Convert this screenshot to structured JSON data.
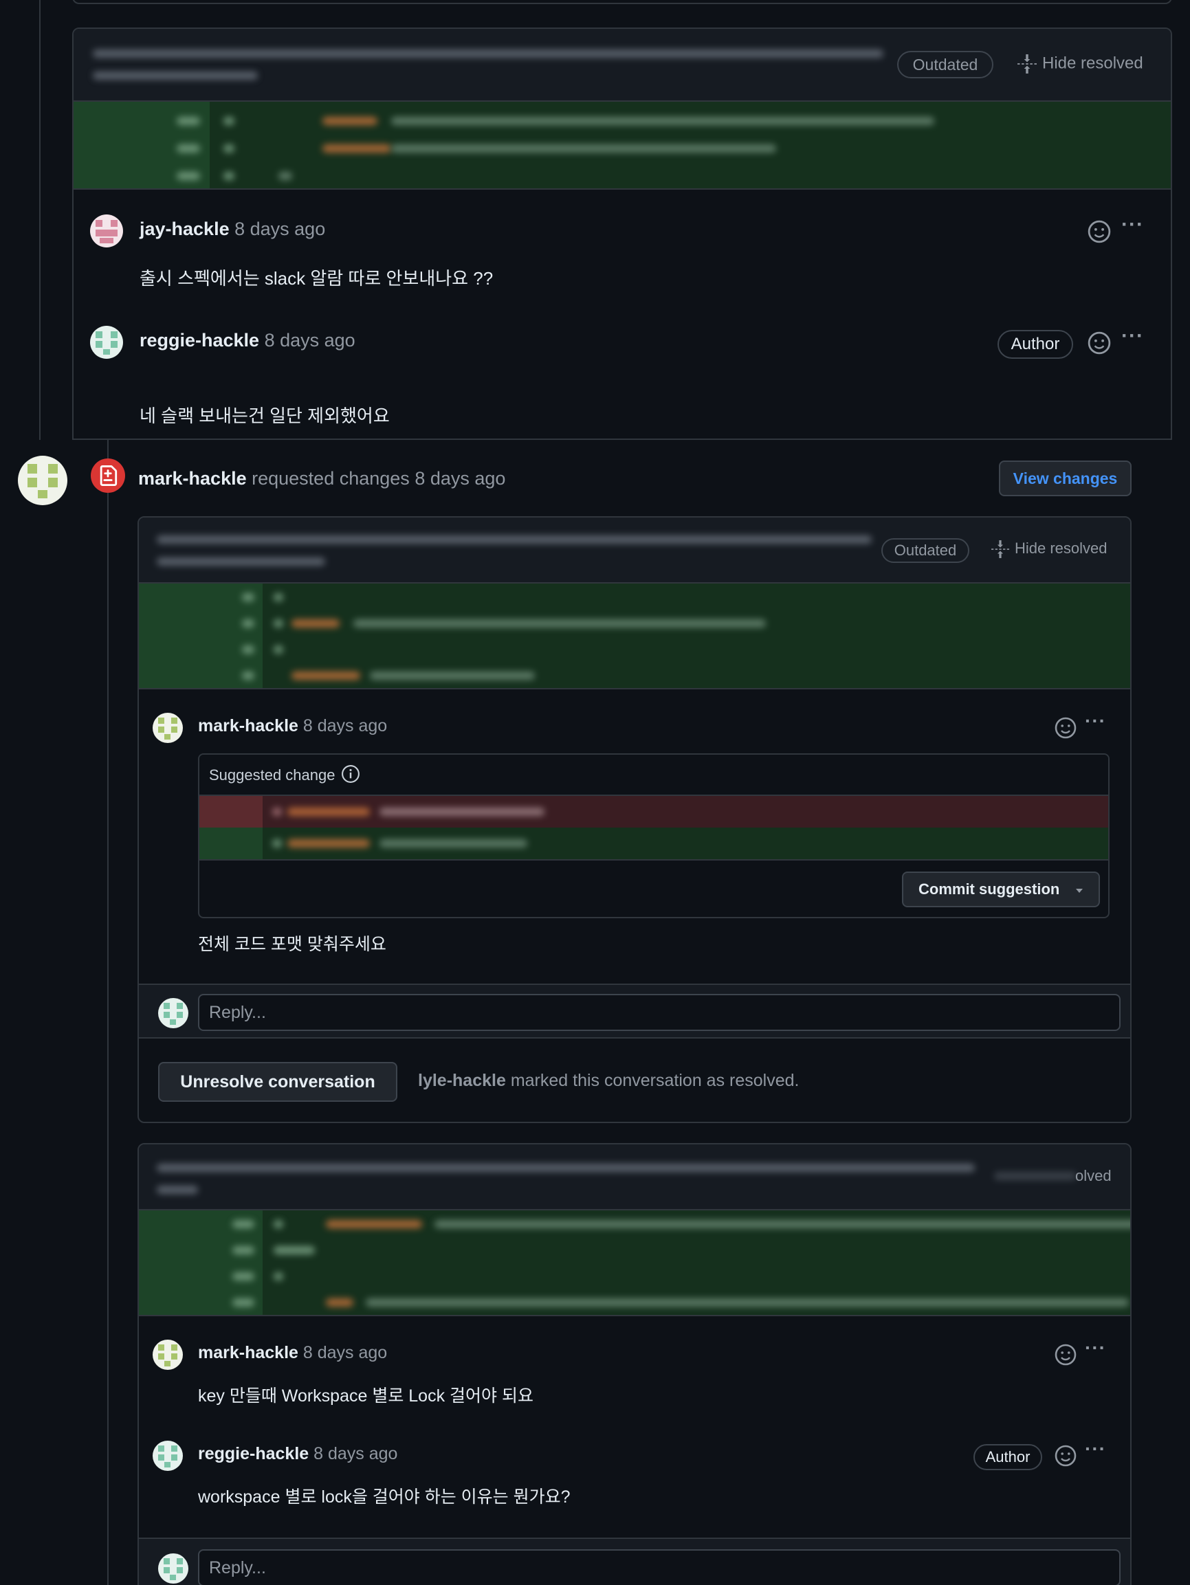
{
  "thread1": {
    "badge_outdated": "Outdated",
    "hide_resolved": "Hide resolved",
    "comments": [
      {
        "author": "jay-hackle",
        "time": "8 days ago",
        "body": "출시 스펙에서는 slack 알람 따로 안보내나요 ??"
      },
      {
        "author": "reggie-hackle",
        "time": "8 days ago",
        "body": "네 슬랙 보내는건 일단 제외했어요",
        "badge": "Author"
      }
    ]
  },
  "review": {
    "author": "mark-hackle",
    "action": "requested changes",
    "time": "8 days ago",
    "view_changes": "View changes"
  },
  "thread2": {
    "badge_outdated": "Outdated",
    "hide_resolved": "Hide resolved",
    "comment": {
      "author": "mark-hackle",
      "time": "8 days ago",
      "body": "전체 코드 포맷 맞춰주세요"
    },
    "suggested_change_label": "Suggested change",
    "commit_suggestion": "Commit suggestion",
    "reply_placeholder": "Reply...",
    "unresolve_button": "Unresolve conversation",
    "resolved_by": "lyle-hackle",
    "resolved_text": "marked this conversation as resolved."
  },
  "thread3": {
    "hide_resolved_partial": "olved",
    "comments": [
      {
        "author": "mark-hackle",
        "time": "8 days ago",
        "body": "key 만들때 Workspace 별로 Lock 걸어야 되요"
      },
      {
        "author": "reggie-hackle",
        "time": "8 days ago",
        "body": "workspace 별로 lock을 걸어야 하는 이유는 뭔가요?",
        "badge": "Author"
      }
    ],
    "reply_placeholder": "Reply..."
  },
  "colors": {
    "background": "#0d1117",
    "border": "#30363d",
    "muted_text": "#9198a1",
    "addition_bg": "#15301d",
    "deletion_bg": "#3a1d22",
    "changes_requested": "#da3633",
    "link_blue": "#4493f8"
  },
  "icons": [
    "smiley-icon",
    "kebab-horizontal-icon",
    "fold-icon",
    "file-diff-icon",
    "info-icon",
    "triangle-down-icon"
  ]
}
